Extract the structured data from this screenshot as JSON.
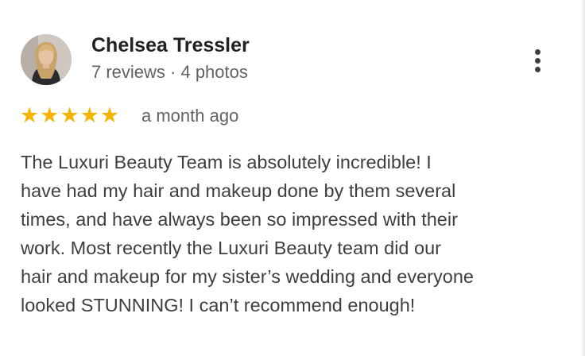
{
  "reviewer": {
    "name": "Chelsea Tressler",
    "stats": "7 reviews · 4 photos",
    "avatar_icon": "person-avatar-icon"
  },
  "rating": {
    "stars": 5,
    "max": 5,
    "star_glyph": "★",
    "star_color": "#f4b400",
    "time_ago": "a month ago"
  },
  "review": {
    "lines": [
      "The Luxuri Beauty Team is absolutely incredible! I",
      "have had my hair and makeup done by them several",
      "times, and have always been so impressed with their",
      "work. Most recently the Luxuri Beauty team did our",
      "hair and makeup for my sister’s wedding and everyone",
      "looked STUNNING! I can’t recommend enough!"
    ]
  },
  "menu": {
    "icon": "more-vertical-icon"
  }
}
